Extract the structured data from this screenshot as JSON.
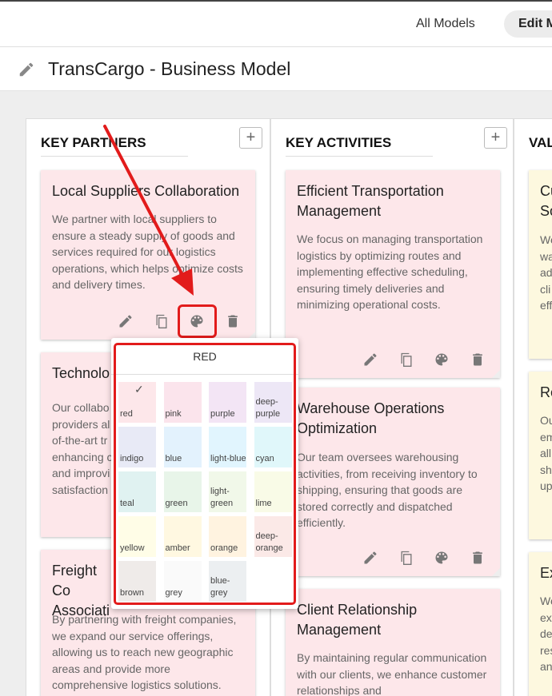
{
  "nav": {
    "all_models": "All Models",
    "edit_model": "Edit M"
  },
  "page": {
    "title": "TransCargo - Business Model"
  },
  "columns": {
    "partners": {
      "title": "KEY PARTNERS",
      "add": "+",
      "cards": [
        {
          "title": "Local Suppliers Collaboration",
          "text": "We partner with local suppliers to ensure a steady supply of goods and services required for our logistics operations, which helps optimize costs and delivery times."
        },
        {
          "title": "Technolo",
          "text": "Our collabo providers al of-the-art tr enhancing c and improvi satisfaction"
        },
        {
          "title": "Freight Co Associati",
          "text": "By partnering with freight companies, we expand our service offerings, allowing us to reach new geographic areas and provide more comprehensive logistics solutions."
        }
      ]
    },
    "activities": {
      "title": "KEY ACTIVITIES",
      "add": "+",
      "cards": [
        {
          "title": "Efficient Transportation Management",
          "text": "We focus on managing transportation logistics by optimizing routes and implementing effective scheduling, ensuring timely deliveries and minimizing operational costs."
        },
        {
          "title": "Warehouse Operations Optimization",
          "text": "Our team oversees warehousing activities, from receiving inventory to shipping, ensuring that goods are stored correctly and dispatched efficiently."
        },
        {
          "title": "Client Relationship Management",
          "text": "By maintaining regular communication with our clients, we enhance customer relationships and"
        }
      ]
    },
    "value": {
      "title": "VAL",
      "cards": [
        {
          "title": "Cu So",
          "text": "We wa ad cli eff"
        },
        {
          "title": "Re",
          "text": "Ou em all sh up"
        },
        {
          "title": "Ex",
          "text": "We ex de res an"
        }
      ]
    }
  },
  "colors": {
    "title": "RED",
    "selected": "red",
    "swatches": [
      {
        "name": "red",
        "hex": "#fde7ea"
      },
      {
        "name": "pink",
        "hex": "#fbe4ec"
      },
      {
        "name": "purple",
        "hex": "#f3e5f5"
      },
      {
        "name": "deep-purple",
        "hex": "#ede7f6"
      },
      {
        "name": "indigo",
        "hex": "#e8eaf6"
      },
      {
        "name": "blue",
        "hex": "#e3f2fd"
      },
      {
        "name": "light-blue",
        "hex": "#e1f5fe"
      },
      {
        "name": "cyan",
        "hex": "#e0f7fa"
      },
      {
        "name": "teal",
        "hex": "#e0f2f1"
      },
      {
        "name": "green",
        "hex": "#e8f5e9"
      },
      {
        "name": "light-green",
        "hex": "#f1f8e9"
      },
      {
        "name": "lime",
        "hex": "#f9fbe7"
      },
      {
        "name": "yellow",
        "hex": "#fffde7"
      },
      {
        "name": "amber",
        "hex": "#fff8e1"
      },
      {
        "name": "orange",
        "hex": "#fff3e0"
      },
      {
        "name": "deep-orange",
        "hex": "#fbe9e7"
      },
      {
        "name": "brown",
        "hex": "#efebe9"
      },
      {
        "name": "grey",
        "hex": "#fafafa"
      },
      {
        "name": "blue-grey",
        "hex": "#eceff1"
      }
    ]
  },
  "theme": {
    "card_red": "#fde7ea",
    "card_yellow": "#fdf8df",
    "annotation_red": "#e21b1b"
  },
  "icons": [
    "pencil-icon",
    "copy-icon",
    "palette-icon",
    "trash-icon",
    "check-icon"
  ]
}
